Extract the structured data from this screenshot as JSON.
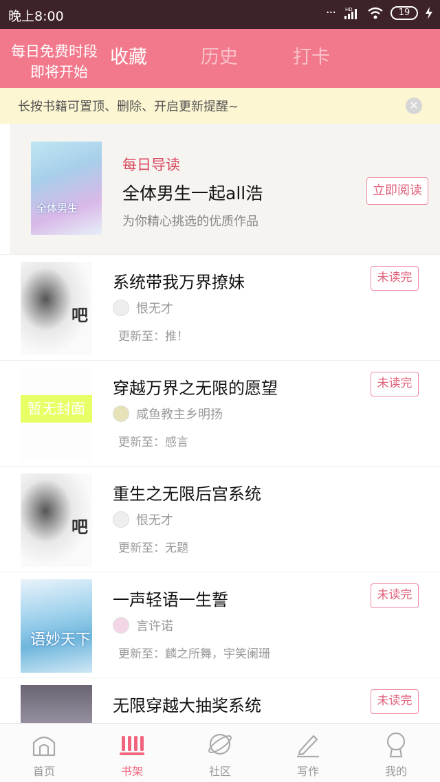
{
  "status_bar": {
    "time": "晚上8:00",
    "network": "HD",
    "battery": "19"
  },
  "header": {
    "promo_line1": "每日免费时段",
    "promo_line2": "即将开始",
    "tabs": [
      {
        "label": "收藏",
        "active": true
      },
      {
        "label": "历史",
        "active": false
      },
      {
        "label": "打卡",
        "active": false
      }
    ]
  },
  "notice": {
    "text": "长按书籍可置顶、删除、开启更新提醒~",
    "close_icon": "close-icon"
  },
  "daily": {
    "label": "每日导读",
    "title": "全体男生一起all浩",
    "description": "为你精心挑选的优质作品",
    "read_button": "立即阅读",
    "cover_text": "全体男生"
  },
  "books": [
    {
      "title": "系统带我万界撩妹",
      "author": "恨无才",
      "update": "更新至：推！",
      "badge": "未读完",
      "cover_mark": "吧"
    },
    {
      "title": "穿越万界之无限的愿望",
      "author": "咸鱼教主乡明扬",
      "update": "更新至：感言",
      "badge": "未读完",
      "cover_text": "暂无封面"
    },
    {
      "title": "重生之无限后宫系统",
      "author": "恨无才",
      "update": "更新至：无题",
      "badge": "",
      "cover_mark": "吧"
    },
    {
      "title": "一声轻语一生誓",
      "author": "言许诺",
      "update": "更新至：麟之所舞，宇笑阑珊",
      "badge": "未读完",
      "cover_text": "语妙天下"
    },
    {
      "title": "无限穿越大抽奖系统",
      "author": "",
      "update": "",
      "badge": "未读完"
    }
  ],
  "bottom_nav": [
    {
      "label": "首页",
      "icon": "home-icon",
      "active": false
    },
    {
      "label": "书架",
      "icon": "bookshelf-icon",
      "active": true
    },
    {
      "label": "社区",
      "icon": "planet-icon",
      "active": false
    },
    {
      "label": "写作",
      "icon": "pen-icon",
      "active": false
    },
    {
      "label": "我的",
      "icon": "profile-icon",
      "active": false
    }
  ],
  "colors": {
    "header": "#f2788b",
    "accent": "#e0607a",
    "status_bar": "#3e2229",
    "notice_bg": "#fdf6d2"
  }
}
